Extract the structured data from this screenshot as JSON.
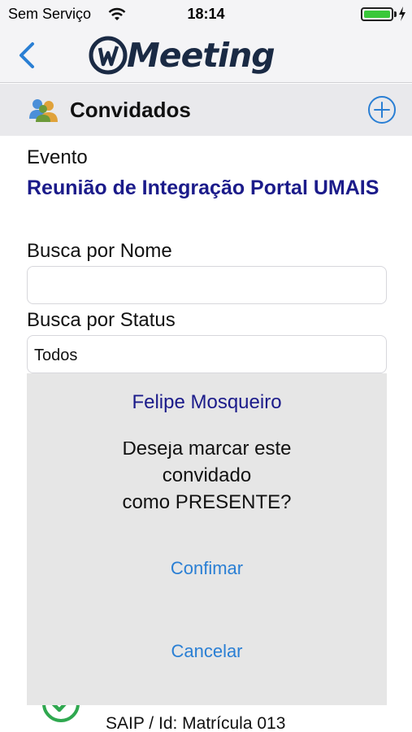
{
  "status_bar": {
    "carrier": "Sem Serviço",
    "time": "18:14",
    "battery_level": 1.0
  },
  "nav": {
    "app_name": "Meeting",
    "back_icon": "chevron-left-icon"
  },
  "section": {
    "title": "Convidados",
    "icon": "people-icon",
    "add_icon": "plus-circle-icon"
  },
  "form": {
    "event_label": "Evento",
    "event_name": "Reunião de Integração Portal UMAIS",
    "name_search_label": "Busca por Nome",
    "name_search_value": "",
    "status_search_label": "Busca por Status",
    "status_search_value": "Todos"
  },
  "dialog": {
    "title": "Felipe Mosqueiro",
    "message_line1": "Deseja marcar este",
    "message_line2": "convidado",
    "message_line3": "como PRESENTE?",
    "confirm_label": "Confimar",
    "cancel_label": "Cancelar"
  },
  "list": {
    "row_text": "SAIP / Id: Matrícula 013",
    "row_icon": "check-circle-icon"
  },
  "colors": {
    "accent": "#2a7fd4",
    "title_blue": "#1b1b8a",
    "battery_green": "#39c83a",
    "check_green": "#2fa84f"
  }
}
